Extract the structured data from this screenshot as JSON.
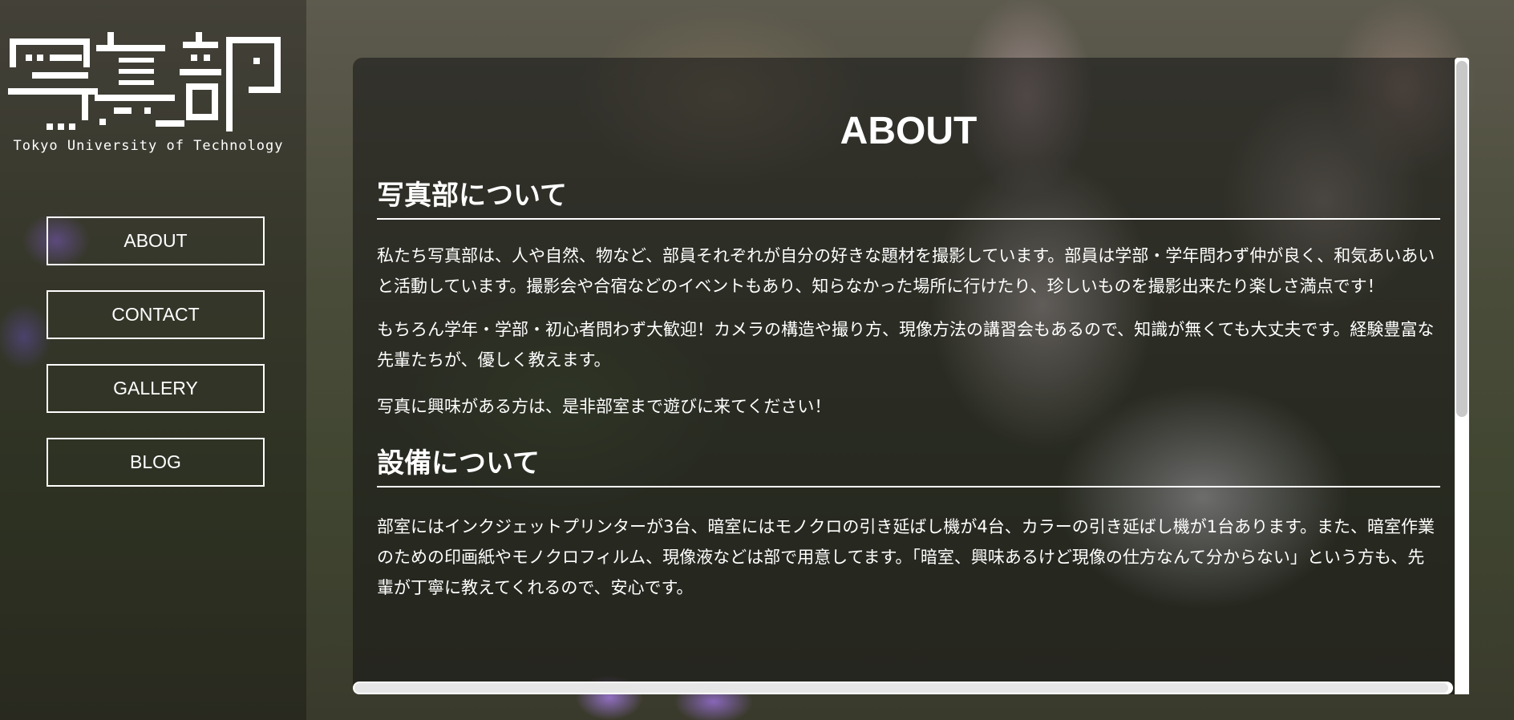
{
  "logo": {
    "title": "写真部",
    "subtitle": "Tokyo University of Technology"
  },
  "nav": {
    "items": [
      {
        "label": "ABOUT"
      },
      {
        "label": "CONTACT"
      },
      {
        "label": "GALLERY"
      },
      {
        "label": "BLOG"
      }
    ]
  },
  "main": {
    "title": "ABOUT",
    "sections": [
      {
        "heading": "写真部について",
        "paragraphs": [
          "私たち写真部は、人や自然、物など、部員それぞれが自分の好きな題材を撮影しています。部員は学部・学年問わず仲が良く、和気あいあいと活動しています。撮影会や合宿などのイベントもあり、知らなかった場所に行けたり、珍しいものを撮影出来たり楽しさ満点です！",
          "もちろん学年・学部・初心者問わず大歓迎！カメラの構造や撮り方、現像方法の講習会もあるので、知識が無くても大丈夫です。経験豊富な先輩たちが、優しく教えます。",
          "写真に興味がある方は、是非部室まで遊びに来てください！"
        ]
      },
      {
        "heading": "設備について",
        "paragraphs": [
          "部室にはインクジェットプリンターが3台、暗室にはモノクロの引き延ばし機が4台、カラーの引き延ばし機が1台あります。また、暗室作業のための印画紙やモノクロフィルム、現像液などは部で用意してます。「暗室、興味あるけど現像の仕方なんて分からない」という方も、先輩が丁寧に教えてくれるので、安心です。"
        ]
      }
    ]
  },
  "colors": {
    "text": "#ffffff",
    "panel_overlay": "rgba(20,20,20,0.55)",
    "sidebar_overlay": "rgba(0,0,0,0.28)",
    "scrollbar": "#ffffff",
    "scrollbar_thumb": "#c8c8c8"
  },
  "icons": {
    "logo": "club-logo-icon"
  }
}
